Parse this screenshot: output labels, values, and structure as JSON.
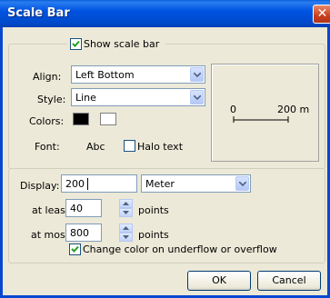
{
  "window": {
    "title": "Scale Bar"
  },
  "show_scale_bar": {
    "label": "Show scale bar",
    "checked": true
  },
  "align": {
    "label": "Align:",
    "value": "Left Bottom"
  },
  "style": {
    "label": "Style:",
    "value": "Line"
  },
  "colors": {
    "label": "Colors:",
    "primary": "#000000",
    "secondary": "#ffffff"
  },
  "font": {
    "label": "Font:",
    "value": "Abc"
  },
  "halo_text": {
    "label": "Halo text",
    "checked": false
  },
  "preview": {
    "start_label": "0",
    "end_label": "200 m"
  },
  "display": {
    "label": "Display:",
    "value": "200",
    "unit": "Meter"
  },
  "at_least": {
    "label": "at least",
    "value": "40",
    "unit": "points"
  },
  "at_most": {
    "label": "at most",
    "value": "800",
    "unit": "points"
  },
  "change_color": {
    "label": "Change color on underflow or overflow",
    "checked": true
  },
  "buttons": {
    "ok": "OK",
    "cancel": "Cancel"
  }
}
